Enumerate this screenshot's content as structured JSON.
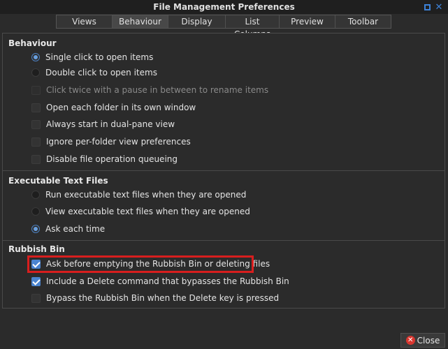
{
  "window": {
    "title": "File Management Preferences"
  },
  "tabs": [
    {
      "label": "Views",
      "active": false
    },
    {
      "label": "Behaviour",
      "active": true
    },
    {
      "label": "Display",
      "active": false
    },
    {
      "label": "List Columns",
      "active": false
    },
    {
      "label": "Preview",
      "active": false
    },
    {
      "label": "Toolbar",
      "active": false
    }
  ],
  "sections": [
    {
      "title": "Behaviour",
      "options": [
        {
          "type": "radio",
          "label": "Single click to open items",
          "checked": true,
          "enabled": true
        },
        {
          "type": "radio",
          "label": "Double click to open items",
          "checked": false,
          "enabled": true
        },
        {
          "type": "checkbox",
          "label": "Click twice with a pause in between to rename items",
          "checked": false,
          "enabled": false
        },
        {
          "type": "checkbox",
          "label": "Open each folder in its own window",
          "checked": false,
          "enabled": true
        },
        {
          "type": "checkbox",
          "label": "Always start in dual-pane view",
          "checked": false,
          "enabled": true
        },
        {
          "type": "checkbox",
          "label": "Ignore per-folder view preferences",
          "checked": false,
          "enabled": true
        },
        {
          "type": "checkbox",
          "label": "Disable file operation queueing",
          "checked": false,
          "enabled": true
        }
      ]
    },
    {
      "title": "Executable Text Files",
      "options": [
        {
          "type": "radio",
          "label": "Run executable text files when they are opened",
          "checked": false,
          "enabled": true
        },
        {
          "type": "radio",
          "label": "View executable text files when they are opened",
          "checked": false,
          "enabled": true
        },
        {
          "type": "radio",
          "label": "Ask each time",
          "checked": true,
          "enabled": true
        }
      ]
    },
    {
      "title": "Rubbish Bin",
      "options": [
        {
          "type": "checkbox",
          "label": "Ask before emptying the Rubbish Bin or deleting files",
          "checked": true,
          "enabled": true
        },
        {
          "type": "checkbox",
          "label": "Include a Delete command that bypasses the Rubbish Bin",
          "checked": true,
          "enabled": true
        },
        {
          "type": "checkbox",
          "label": "Bypass the Rubbish Bin when the Delete key is pressed",
          "checked": false,
          "enabled": true
        }
      ]
    }
  ],
  "footer": {
    "close_label": "Close"
  },
  "colors": {
    "accent": "#4a84cf",
    "highlight": "#d81e1e",
    "close_icon": "#d9362f"
  }
}
